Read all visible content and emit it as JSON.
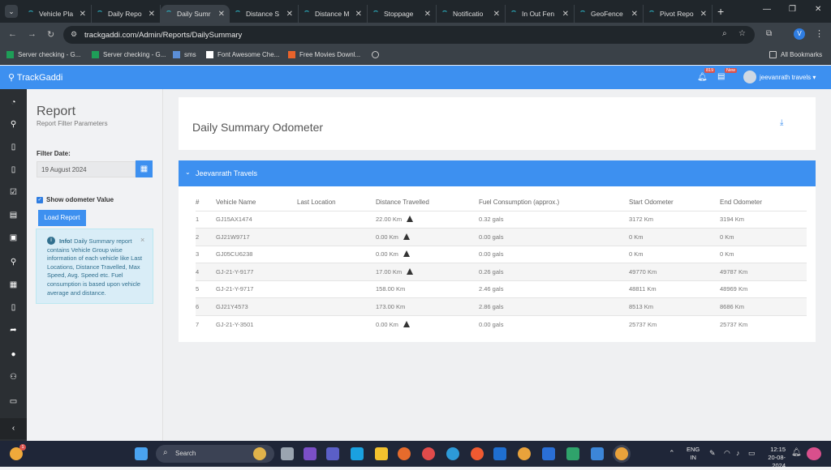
{
  "browser": {
    "tabs": [
      {
        "title": "Vehicle Pla",
        "active": false
      },
      {
        "title": "Daily Repo",
        "active": false
      },
      {
        "title": "Daily Sumr",
        "active": true
      },
      {
        "title": "Distance S",
        "active": false
      },
      {
        "title": "Distance M",
        "active": false
      },
      {
        "title": "Stoppage",
        "active": false
      },
      {
        "title": "Notificatio",
        "active": false
      },
      {
        "title": "In Out Fen",
        "active": false
      },
      {
        "title": "GeoFence",
        "active": false
      },
      {
        "title": "Pivot Repo",
        "active": false
      }
    ],
    "url": "trackgaddi.com/Admin/Reports/DailySummary",
    "profile_initial": "V",
    "bookmarks": [
      {
        "label": "Server checking - G...",
        "icon": "sheets-icon",
        "color": "#1e9e58"
      },
      {
        "label": "Server checking - G...",
        "icon": "sheets-icon",
        "color": "#1e9e58"
      },
      {
        "label": "sms",
        "icon": "doc-icon",
        "color": "#5b8ed6"
      },
      {
        "label": "Font Awesome Che...",
        "icon": "flag-icon",
        "color": "#ffffff"
      },
      {
        "label": "Free Movies Downl...",
        "icon": "movie-icon",
        "color": "#e8632b"
      },
      {
        "label": "",
        "icon": "globe-icon",
        "color": "#cccccc"
      }
    ],
    "all_bookmarks": "All Bookmarks"
  },
  "app": {
    "brand": "TrackGaddi",
    "notif_count": "819",
    "new_badge": "New",
    "user": "jeevanrath travels",
    "accent": "#3d90f0"
  },
  "filter": {
    "title": "Report",
    "subtitle": "Report Filter Parameters",
    "date_label": "Filter Date:",
    "date_value": "19 August 2024",
    "odometer_label": "Show odometer Value",
    "load_button": "Load Report",
    "info_title": "Info!",
    "info_text": "Daily Summary report contains Vehicle Group wise information of each vehicle like Last Locations, Distance Travelled, Max Speed, Avg. Speed etc. Fuel consumption is based upon vehicle average and distance."
  },
  "main": {
    "page_title": "Daily Summary Odometer",
    "group_name": "Jeevanrath Travels",
    "columns": [
      "#",
      "Vehicle Name",
      "Last Location",
      "Distance Travelled",
      "Fuel Consumption (approx.)",
      "Start Odometer",
      "End Odometer"
    ],
    "rows": [
      {
        "n": "1",
        "vehicle": "GJ15AX1474",
        "location": "",
        "distance": "22.00 Km",
        "warn": true,
        "fuel": "0.32 gals",
        "start": "3172 Km",
        "end": "3194 Km"
      },
      {
        "n": "2",
        "vehicle": "GJ21W9717",
        "location": "",
        "distance": "0.00 Km",
        "warn": true,
        "fuel": "0.00 gals",
        "start": "0 Km",
        "end": "0 Km"
      },
      {
        "n": "3",
        "vehicle": "GJ05CU6238",
        "location": "",
        "distance": "0.00 Km",
        "warn": true,
        "fuel": "0.00 gals",
        "start": "0 Km",
        "end": "0 Km"
      },
      {
        "n": "4",
        "vehicle": "GJ-21-Y-9177",
        "location": "",
        "distance": "17.00 Km",
        "warn": true,
        "fuel": "0.26 gals",
        "start": "49770 Km",
        "end": "49787 Km"
      },
      {
        "n": "5",
        "vehicle": "GJ-21-Y-9717",
        "location": "",
        "distance": "158.00 Km",
        "warn": false,
        "fuel": "2.46 gals",
        "start": "48811 Km",
        "end": "48969 Km"
      },
      {
        "n": "6",
        "vehicle": "GJ21Y4573",
        "location": "",
        "distance": "173.00 Km",
        "warn": false,
        "fuel": "2.86 gals",
        "start": "8513 Km",
        "end": "8686 Km"
      },
      {
        "n": "7",
        "vehicle": "GJ-21-Y-3501",
        "location": "",
        "distance": "0.00 Km",
        "warn": true,
        "fuel": "0.00 gals",
        "start": "25737 Km",
        "end": "25737 Km"
      }
    ]
  },
  "taskbar": {
    "search_placeholder": "Search",
    "lang": "ENG",
    "region": "IN",
    "time": "12:15",
    "date": "20-08-2024",
    "weather_badge": "1"
  }
}
